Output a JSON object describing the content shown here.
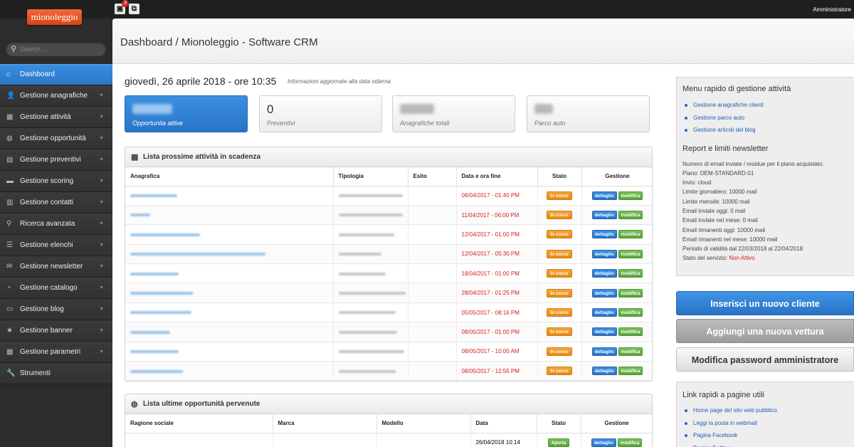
{
  "app": {
    "logo": "mionoleggio",
    "user": "Amministratore",
    "notification_count": "3"
  },
  "search": {
    "placeholder": "Search..."
  },
  "sidebar": {
    "items": [
      {
        "label": "Dashboard",
        "icon": "home-icon",
        "glyph": "⌂",
        "active": true
      },
      {
        "label": "Gestione anagrafiche",
        "icon": "user-icon",
        "glyph": "👤"
      },
      {
        "label": "Gestione attività",
        "icon": "calendar-icon",
        "glyph": "▦"
      },
      {
        "label": "Gestione opportunità",
        "icon": "globe-icon",
        "glyph": "◍"
      },
      {
        "label": "Gestione preventivi",
        "icon": "document-icon",
        "glyph": "▤"
      },
      {
        "label": "Gestione scoring",
        "icon": "folder-icon",
        "glyph": "▬"
      },
      {
        "label": "Gestione contatti",
        "icon": "book-icon",
        "glyph": "▥"
      },
      {
        "label": "Ricerca avanzata",
        "icon": "search-icon",
        "glyph": "⚲"
      },
      {
        "label": "Gestione elenchi",
        "icon": "list-icon",
        "glyph": "☰"
      },
      {
        "label": "Gestione newsletter",
        "icon": "mail-icon",
        "glyph": "✉"
      },
      {
        "label": "Gestione catalogo",
        "icon": "gauge-icon",
        "glyph": "◔"
      },
      {
        "label": "Gestione blog",
        "icon": "chat-icon",
        "glyph": "▭"
      },
      {
        "label": "Gestione banner",
        "icon": "star-icon",
        "glyph": "★"
      },
      {
        "label": "Gestione parametri",
        "icon": "grid-icon",
        "glyph": "▦"
      },
      {
        "label": "Strumenti",
        "icon": "wrench-icon",
        "glyph": "🔧"
      }
    ]
  },
  "header": {
    "title": "Dashboard / Mionoleggio - Software CRM"
  },
  "date": {
    "text": "giovedì, 26 aprile 2018 - ore 10:35",
    "note": "Informazioni aggiornate alla data odierna"
  },
  "cards": [
    {
      "value": "",
      "label": "Opportunita attive"
    },
    {
      "value": "0",
      "label": "Preventivi"
    },
    {
      "value": "",
      "label": "Anagrafiche totali"
    },
    {
      "value": "",
      "label": "Parco auto"
    }
  ],
  "activities": {
    "title": "Lista prossime attività in scadenza",
    "columns": [
      "Anagrafica",
      "Tipologia",
      "Esito",
      "Data e ora fine",
      "Stato",
      "Gestione"
    ],
    "rows": [
      {
        "date": "06/04/2017 - 01:40 PM",
        "stato": "In corso"
      },
      {
        "date": "11/04/2017 - 06:00 PM",
        "stato": "In corso"
      },
      {
        "date": "12/04/2017 - 01:00 PM",
        "stato": "In corso"
      },
      {
        "date": "12/04/2017 - 05:30 PM",
        "stato": "In corso"
      },
      {
        "date": "18/04/2017 - 01:00 PM",
        "stato": "In corso"
      },
      {
        "date": "28/04/2017 - 01:25 PM",
        "stato": "In corso"
      },
      {
        "date": "05/05/2017 - 08:16 PM",
        "stato": "In corso"
      },
      {
        "date": "08/05/2017 - 01:00 PM",
        "stato": "In corso"
      },
      {
        "date": "08/05/2017 - 10:00 AM",
        "stato": "In corso"
      },
      {
        "date": "08/05/2017 - 12:55 PM",
        "stato": "In corso"
      }
    ],
    "btn_detail": "dettaglio",
    "btn_edit": "modifica"
  },
  "opportunities": {
    "title": "Lista ultime opportunità pervenute",
    "columns": [
      "Ragione sociale",
      "Marca",
      "Modello",
      "Data",
      "Stato",
      "Gestione"
    ],
    "rows": [
      {
        "date": "26/04/2018 10:14",
        "stato": "Aperta"
      }
    ],
    "btn_detail": "dettaglio",
    "btn_edit": "modifica"
  },
  "quick_menu": {
    "title": "Menu rapido di gestione attività",
    "links": [
      "Gestione anagrafiche clienti",
      "Gestione parco auto",
      "Gestione articoli del blog"
    ]
  },
  "newsletter_report": {
    "title": "Report e limiti newsletter",
    "lines": [
      "Numero di email inviate / residue per il piano acquistato.",
      "Piano: DEM-STANDARD-01",
      "Invio: cloud",
      "Limite giornaliero: 10000 mail",
      "Limite mensile: 10000 mail",
      "Email inviate oggi: 0 mail",
      "Email inviate nel mese: 0 mail",
      "Email rimanenti oggi: 10000 mail",
      "Email rimanenti nel mese: 10000 mail",
      "Periodo di validità dal 22/03/2018 al 22/04/2018"
    ],
    "status_label": "Stato del servizio: ",
    "status_value": "Non Attivo"
  },
  "actions": {
    "new_client": "Inserisci un nuovo cliente",
    "new_car": "Aggiungi una nuova vettura",
    "change_password": "Modifica password amministratore"
  },
  "useful_links": {
    "title": "Link rapidi a pagine utili",
    "links": [
      "Home page del sito web pubblico",
      "Leggi la posta in webmail",
      "Pagina Facebook",
      "Pagina Twitter"
    ]
  },
  "colors": {
    "accent_blue": "#2a76c9",
    "status_orange": "#e68a12",
    "status_green": "#5aa43a",
    "date_red": "#d42020"
  }
}
